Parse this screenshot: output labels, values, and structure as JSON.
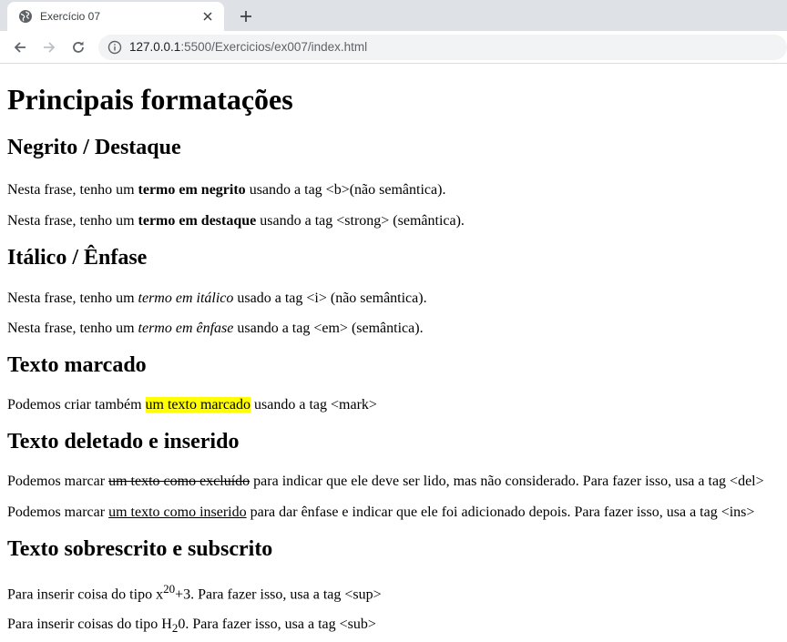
{
  "browser": {
    "tab_title": "Exercício 07",
    "url_host": "127.0.0.1",
    "url_rest": ":5500/Exercicios/ex007/index.html"
  },
  "page": {
    "title": "Principais formatações",
    "sec_bold": {
      "heading": "Negrito / Destaque",
      "p1": {
        "a": "Nesta frase, tenho um ",
        "b": "termo em negrito",
        "c": " usando a tag <b>(não semântica)."
      },
      "p2": {
        "a": "Nesta frase, tenho um ",
        "b": "termo em destaque",
        "c": " usando a tag <strong> (semântica)."
      }
    },
    "sec_italic": {
      "heading": "Itálico / Ênfase",
      "p1": {
        "a": "Nesta frase, tenho um ",
        "b": "termo em itálico",
        "c": " usado a tag <i> (não semântica)."
      },
      "p2": {
        "a": "Nesta frase, tenho um ",
        "b": "termo em ênfase",
        "c": " usando a tag <em> (semântica)."
      }
    },
    "sec_mark": {
      "heading": "Texto marcado",
      "p1": {
        "a": "Podemos criar também ",
        "b": "um texto marcado",
        "c": " usando a tag <mark>"
      }
    },
    "sec_delins": {
      "heading": "Texto deletado e inserido",
      "p1": {
        "a": "Podemos marcar ",
        "b": "um texto como excluído",
        "c": " para indicar que ele deve ser lido, mas não considerado. Para fazer isso, usa a tag <del>"
      },
      "p2": {
        "a": "Podemos marcar ",
        "b": "um texto como inserido",
        "c": " para dar ênfase e indicar que ele foi adicionado depois. Para fazer isso, usa a tag <ins>"
      }
    },
    "sec_supsub": {
      "heading": "Texto sobrescrito e subscrito",
      "p1": {
        "a": "Para inserir coisa do tipo x",
        "b": "20",
        "c": "+3. Para fazer isso, usa a tag <sup>"
      },
      "p2": {
        "a": "Para inserir coisas do tipo H",
        "b": "2",
        "c": "0. Para fazer isso, usa a tag <sub>"
      }
    }
  }
}
